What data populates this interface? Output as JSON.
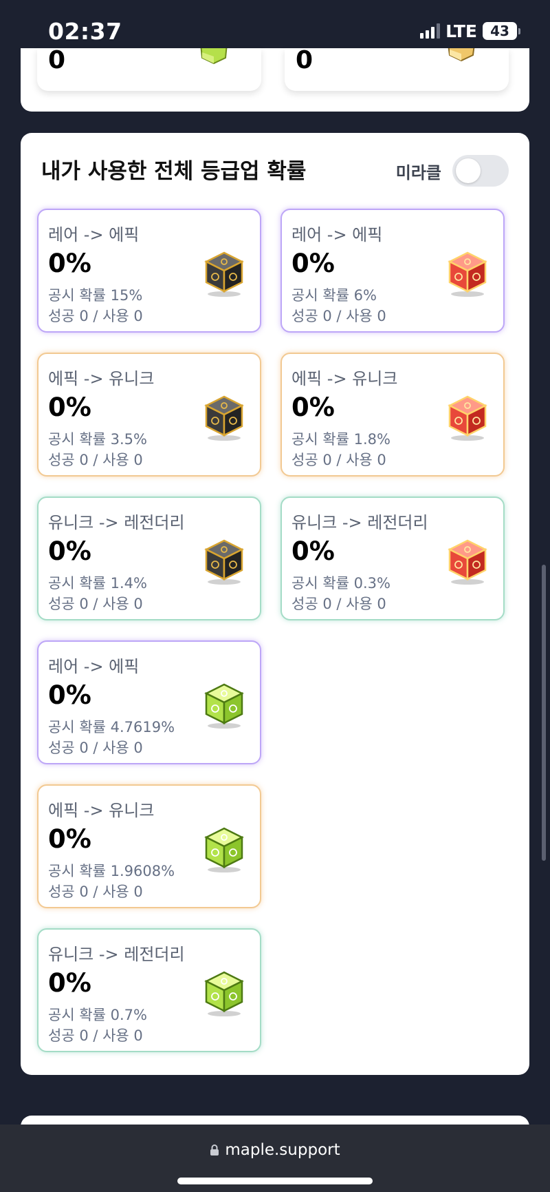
{
  "status": {
    "time": "02:37",
    "network": "LTE",
    "battery": "43"
  },
  "top_cards": [
    {
      "value": "0",
      "icon": "green-cube-icon"
    },
    {
      "value": "0",
      "icon": "gold-cube-icon"
    }
  ],
  "section": {
    "title": "내가 사용한 전체 등급업 확률",
    "miracle_label": "미라클",
    "miracle_enabled": false
  },
  "cards": [
    {
      "title": "레어 -> 에픽",
      "value": "0%",
      "official": "공시 확률 15%",
      "count": "성공 0 / 사용 0",
      "tier": "rare",
      "icon": "black-cube-icon"
    },
    {
      "title": "레어 -> 에픽",
      "value": "0%",
      "official": "공시 확률 6%",
      "count": "성공 0 / 사용 0",
      "tier": "rare",
      "icon": "red-cube-icon"
    },
    {
      "title": "에픽 -> 유니크",
      "value": "0%",
      "official": "공시 확률 3.5%",
      "count": "성공 0 / 사용 0",
      "tier": "epic",
      "icon": "black-cube-icon"
    },
    {
      "title": "에픽 -> 유니크",
      "value": "0%",
      "official": "공시 확률 1.8%",
      "count": "성공 0 / 사용 0",
      "tier": "epic",
      "icon": "red-cube-icon"
    },
    {
      "title": "유니크 -> 레전더리",
      "value": "0%",
      "official": "공시 확률 1.4%",
      "count": "성공 0 / 사용 0",
      "tier": "unique",
      "icon": "black-cube-icon"
    },
    {
      "title": "유니크 -> 레전더리",
      "value": "0%",
      "official": "공시 확률 0.3%",
      "count": "성공 0 / 사용 0",
      "tier": "unique",
      "icon": "red-cube-icon"
    },
    {
      "title": "레어 -> 에픽",
      "value": "0%",
      "official": "공시 확률 4.7619%",
      "count": "성공 0 / 사용 0",
      "tier": "rare",
      "icon": "green-cube-icon"
    },
    {
      "title": "에픽 -> 유니크",
      "value": "0%",
      "official": "공시 확률 1.9608%",
      "count": "성공 0 / 사용 0",
      "tier": "epic",
      "icon": "green-cube-icon"
    },
    {
      "title": "유니크 -> 레전더리",
      "value": "0%",
      "official": "공시 확률 0.7%",
      "count": "성공 0 / 사용 0",
      "tier": "unique",
      "icon": "green-cube-icon"
    }
  ],
  "browser": {
    "url": "maple.support"
  },
  "colors": {
    "background": "#1c2130",
    "rare_border": "#bda6f7",
    "epic_border": "#f2c992",
    "unique_border": "#a4dcc6"
  }
}
